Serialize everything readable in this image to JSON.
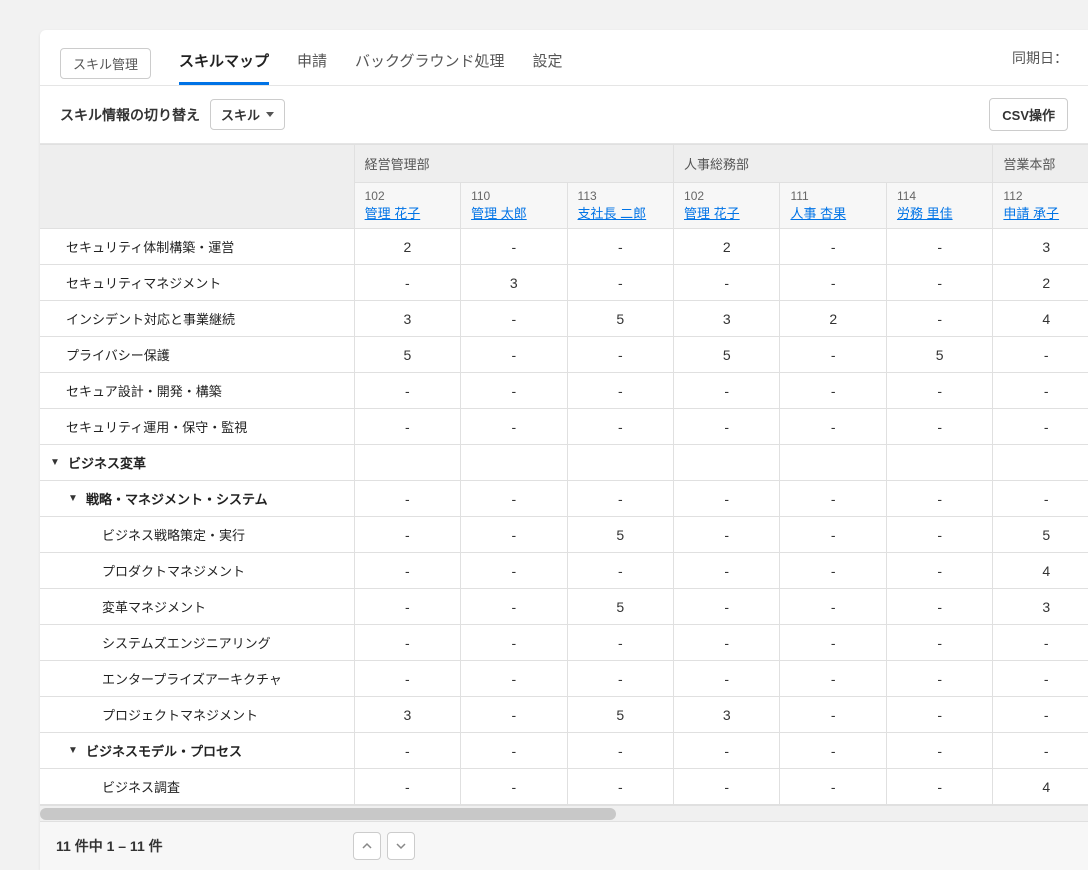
{
  "tabs": {
    "pill": "スキル管理",
    "items": [
      "スキルマップ",
      "申請",
      "バックグラウンド処理",
      "設定"
    ],
    "active_index": 0
  },
  "sync_label": "同期日：",
  "toolbar": {
    "switch_label": "スキル情報の切り替え",
    "select_value": "スキル",
    "csv_button": "CSV操作"
  },
  "departments": [
    {
      "name": "経営管理部",
      "span": 3
    },
    {
      "name": "人事総務部",
      "span": 3
    },
    {
      "name": "営業本部",
      "span": 1
    }
  ],
  "employees": [
    {
      "code": "102",
      "name": "管理 花子"
    },
    {
      "code": "110",
      "name": "管理 太郎"
    },
    {
      "code": "113",
      "name": "支社長 二郎"
    },
    {
      "code": "102",
      "name": "管理 花子"
    },
    {
      "code": "111",
      "name": "人事 杏果"
    },
    {
      "code": "114",
      "name": "労務 里佳"
    },
    {
      "code": "112",
      "name": "申請 承子"
    }
  ],
  "rows": [
    {
      "label": "セキュリティ体制構築・運営",
      "indent": 1,
      "expand": false,
      "bold": false,
      "values": [
        "2",
        "-",
        "-",
        "2",
        "-",
        "-",
        "3"
      ]
    },
    {
      "label": "セキュリティマネジメント",
      "indent": 1,
      "expand": false,
      "bold": false,
      "values": [
        "-",
        "3",
        "-",
        "-",
        "-",
        "-",
        "2"
      ]
    },
    {
      "label": "インシデント対応と事業継続",
      "indent": 1,
      "expand": false,
      "bold": false,
      "values": [
        "3",
        "-",
        "5",
        "3",
        "2",
        "-",
        "4"
      ]
    },
    {
      "label": "プライバシー保護",
      "indent": 1,
      "expand": false,
      "bold": false,
      "values": [
        "5",
        "-",
        "-",
        "5",
        "-",
        "5",
        "-"
      ]
    },
    {
      "label": "セキュア設計・開発・構築",
      "indent": 1,
      "expand": false,
      "bold": false,
      "values": [
        "-",
        "-",
        "-",
        "-",
        "-",
        "-",
        "-"
      ]
    },
    {
      "label": "セキュリティ運用・保守・監視",
      "indent": 1,
      "expand": false,
      "bold": false,
      "values": [
        "-",
        "-",
        "-",
        "-",
        "-",
        "-",
        "-"
      ]
    },
    {
      "label": "ビジネス変革",
      "indent": 1,
      "expand": true,
      "bold": true,
      "values": [
        "",
        "",
        "",
        "",
        "",
        "",
        ""
      ]
    },
    {
      "label": "戦略・マネジメント・システム",
      "indent": 2,
      "expand": true,
      "bold": true,
      "values": [
        "-",
        "-",
        "-",
        "-",
        "-",
        "-",
        "-"
      ]
    },
    {
      "label": "ビジネス戦略策定・実行",
      "indent": 3,
      "expand": false,
      "bold": false,
      "values": [
        "-",
        "-",
        "5",
        "-",
        "-",
        "-",
        "5"
      ]
    },
    {
      "label": "プロダクトマネジメント",
      "indent": 3,
      "expand": false,
      "bold": false,
      "values": [
        "-",
        "-",
        "-",
        "-",
        "-",
        "-",
        "4"
      ]
    },
    {
      "label": "変革マネジメント",
      "indent": 3,
      "expand": false,
      "bold": false,
      "values": [
        "-",
        "-",
        "5",
        "-",
        "-",
        "-",
        "3"
      ]
    },
    {
      "label": "システムズエンジニアリング",
      "indent": 3,
      "expand": false,
      "bold": false,
      "values": [
        "-",
        "-",
        "-",
        "-",
        "-",
        "-",
        "-"
      ]
    },
    {
      "label": "エンタープライズアーキクチャ",
      "indent": 3,
      "expand": false,
      "bold": false,
      "values": [
        "-",
        "-",
        "-",
        "-",
        "-",
        "-",
        "-"
      ]
    },
    {
      "label": "プロジェクトマネジメント",
      "indent": 3,
      "expand": false,
      "bold": false,
      "values": [
        "3",
        "-",
        "5",
        "3",
        "-",
        "-",
        "-"
      ]
    },
    {
      "label": "ビジネスモデル・プロセス",
      "indent": 2,
      "expand": true,
      "bold": true,
      "values": [
        "-",
        "-",
        "-",
        "-",
        "-",
        "-",
        "-"
      ]
    },
    {
      "label": "ビジネス調査",
      "indent": 3,
      "expand": false,
      "bold": false,
      "values": [
        "-",
        "-",
        "-",
        "-",
        "-",
        "-",
        "4"
      ]
    }
  ],
  "footer": {
    "text": "11 件中  1 – 11 件"
  }
}
